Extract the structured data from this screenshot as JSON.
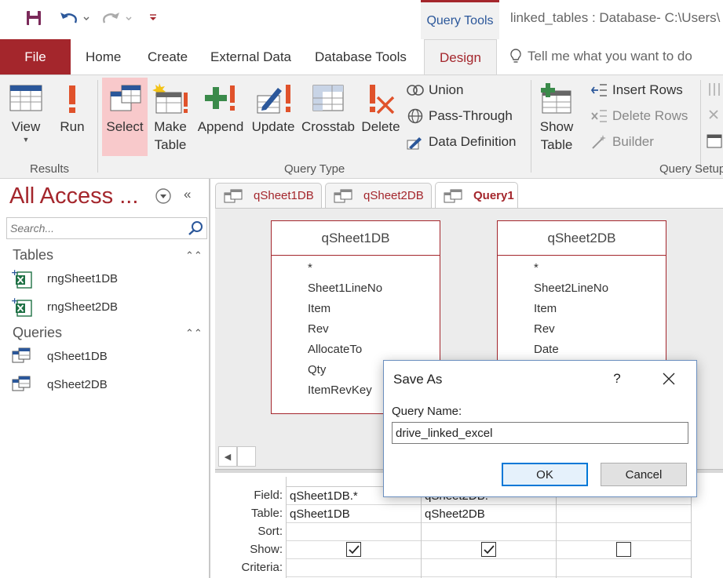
{
  "window": {
    "contextual_tab": "Query Tools",
    "title": "linked_tables : Database- C:\\Users\\"
  },
  "ribbon_tabs": {
    "file": "File",
    "home": "Home",
    "create": "Create",
    "external_data": "External Data",
    "database_tools": "Database Tools",
    "design": "Design",
    "tell_me": "Tell me what you want to do"
  },
  "ribbon": {
    "results": {
      "label": "Results",
      "view": "View",
      "run": "Run"
    },
    "query_type": {
      "label": "Query Type",
      "select": "Select",
      "make_table_1": "Make",
      "make_table_2": "Table",
      "append": "Append",
      "update": "Update",
      "crosstab": "Crosstab",
      "delete": "Delete",
      "union": "Union",
      "pass_through": "Pass-Through",
      "data_definition": "Data Definition"
    },
    "query_setup": {
      "label": "Query Setup",
      "show_table_1": "Show",
      "show_table_2": "Table",
      "insert_rows": "Insert Rows",
      "delete_rows": "Delete Rows",
      "builder": "Builder"
    }
  },
  "nav": {
    "title": "All Access ...",
    "search_placeholder": "Search...",
    "sections": [
      {
        "name": "Tables",
        "items": [
          "rngSheet1DB",
          "rngSheet2DB"
        ]
      },
      {
        "name": "Queries",
        "items": [
          "qSheet1DB",
          "qSheet2DB"
        ]
      }
    ]
  },
  "doc_tabs": [
    "qSheet1DB",
    "qSheet2DB",
    "Query1"
  ],
  "designer": {
    "tables": [
      {
        "name": "qSheet1DB",
        "fields": [
          "*",
          "Sheet1LineNo",
          "Item",
          "Rev",
          "AllocateTo",
          "Qty",
          "ItemRevKey"
        ]
      },
      {
        "name": "qSheet2DB",
        "fields": [
          "*",
          "Sheet2LineNo",
          "Item",
          "Rev",
          "Date"
        ]
      }
    ]
  },
  "qbe": {
    "row_labels": [
      "Field:",
      "Table:",
      "Sort:",
      "Show:",
      "Criteria:"
    ],
    "columns": [
      {
        "field": "qSheet1DB.*",
        "table": "qSheet1DB",
        "show": true
      },
      {
        "field": "qSheet2DB.*",
        "table": "qSheet2DB",
        "show": true
      },
      {
        "field": "",
        "table": "",
        "show": false
      }
    ]
  },
  "dialog": {
    "title": "Save As",
    "help": "?",
    "label": "Query Name:",
    "value": "drive_linked_excel",
    "ok": "OK",
    "cancel": "Cancel"
  },
  "colors": {
    "accent": "#a4262c",
    "blue": "#2b579a",
    "excel_green": "#1e7145"
  }
}
